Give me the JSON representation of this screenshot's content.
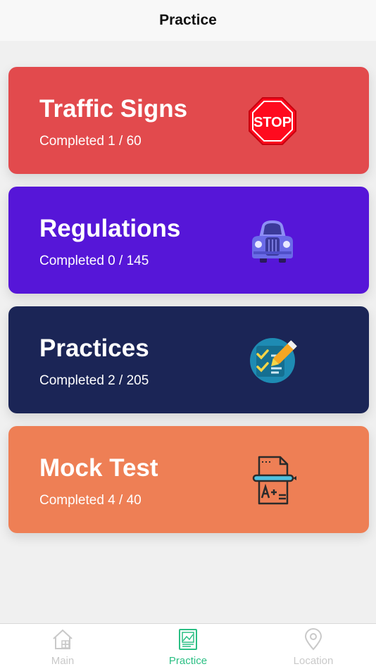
{
  "header": {
    "title": "Practice"
  },
  "cards": [
    {
      "title": "Traffic Signs",
      "progress": "Completed 1 / 60",
      "color": "#e24a4d",
      "icon": "stop-sign-icon",
      "icon_text": "STOP"
    },
    {
      "title": "Regulations",
      "progress": "Completed 0 / 145",
      "color": "#5616d8",
      "icon": "car-icon"
    },
    {
      "title": "Practices",
      "progress": "Completed 2 / 205",
      "color": "#1b2556",
      "icon": "checklist-icon"
    },
    {
      "title": "Mock Test",
      "progress": "Completed 4 / 40",
      "color": "#ee7f55",
      "icon": "test-paper-icon"
    }
  ],
  "tabbar": {
    "items": [
      {
        "label": "Main",
        "icon": "home-icon",
        "active": false
      },
      {
        "label": "Practice",
        "icon": "practice-icon",
        "active": true
      },
      {
        "label": "Location",
        "icon": "location-pin-icon",
        "active": false
      }
    ],
    "active_color": "#2bbf84",
    "inactive_color": "#c9c9c9"
  }
}
